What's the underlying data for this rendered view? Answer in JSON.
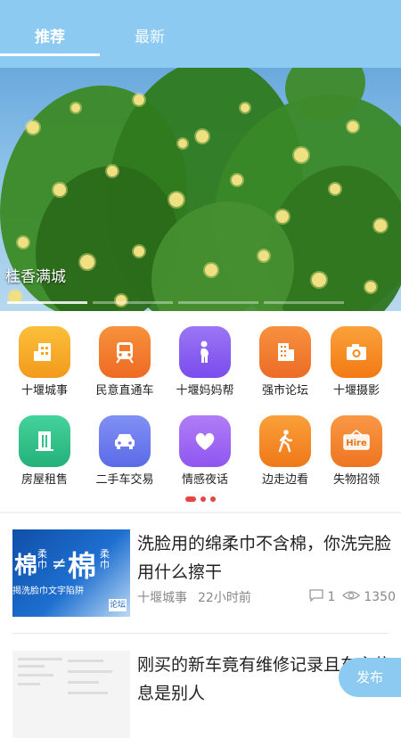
{
  "tabs": [
    {
      "label": "推荐",
      "active": true
    },
    {
      "label": "最新",
      "active": false
    }
  ],
  "banner": {
    "title": "桂香满城"
  },
  "grid": [
    {
      "label": "十堰城事",
      "icon": "building-icon",
      "color": "#f7a323"
    },
    {
      "label": "民意直通车",
      "icon": "train-icon",
      "color": "#f27a2a"
    },
    {
      "label": "十堰妈妈帮",
      "icon": "pregnant-mother-icon",
      "color": "#8a5cf0"
    },
    {
      "label": "强市论坛",
      "icon": "office-building-icon",
      "color": "#f07c2c"
    },
    {
      "label": "十堰摄影",
      "icon": "camera-icon",
      "color": "#f58a1a"
    },
    {
      "label": "房屋租售",
      "icon": "house-icon",
      "color": "#32c48a"
    },
    {
      "label": "二手车交易",
      "icon": "car-icon",
      "color": "#6d7df0"
    },
    {
      "label": "情感夜话",
      "icon": "heart-icon",
      "color": "#a369f4"
    },
    {
      "label": "边走边看",
      "icon": "walking-person-icon",
      "color": "#f28a2a"
    },
    {
      "label": "失物招领",
      "icon": "hire-sign-icon",
      "color": "#f4872c"
    }
  ],
  "articles": [
    {
      "title": "洗脸用的绵柔巾不含棉，你洗完脸用什么擦干",
      "source": "十堰城事",
      "time": "22小时前",
      "comments": "1",
      "views": "1350",
      "thumb": {
        "big": "棉",
        "left": "柔巾",
        "right": "柔巾",
        "neq": "≠",
        "caption": "揭洗脸巾文字陷阱",
        "tag": "论坛"
      }
    },
    {
      "title": "刚买的新车竟有维修记录且车主信息是别人",
      "source": "",
      "time": "",
      "comments": "",
      "views": ""
    }
  ],
  "fab": {
    "label": "发布"
  }
}
